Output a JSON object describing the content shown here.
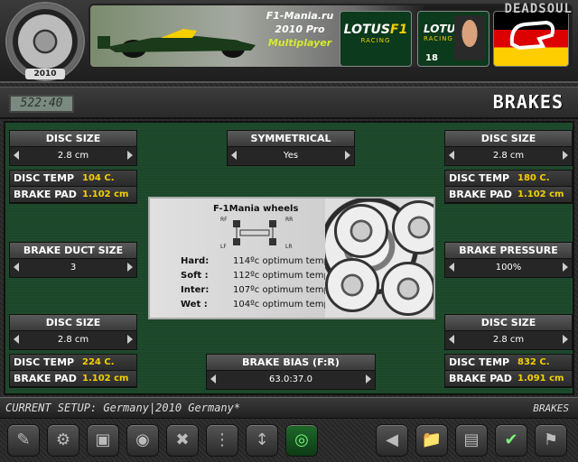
{
  "header": {
    "logo_year": "2010",
    "app_title_line1": "F1-Mania.ru",
    "app_title_line2": "2010 Pro",
    "app_title_line3": "Multiplayer",
    "team_logo_1": {
      "lotus": "LOTUS",
      "f1": "F1",
      "racing": "RACING"
    },
    "team_logo_2": {
      "lotus": "LOTUS",
      "f1": "F1",
      "racing": "RACING"
    },
    "driver_number": "18",
    "brand": "DEADSOUL"
  },
  "subbar": {
    "clock": "522:40",
    "page_title": "BRAKES"
  },
  "settings": {
    "front_left_disc_size": {
      "label": "DISC SIZE",
      "value": "2.8 cm"
    },
    "symmetrical": {
      "label": "SYMMETRICAL",
      "value": "Yes"
    },
    "front_right_disc_size": {
      "label": "DISC SIZE",
      "value": "2.8 cm"
    },
    "brake_duct_size": {
      "label": "BRAKE DUCT SIZE",
      "value": "3"
    },
    "brake_pressure": {
      "label": "BRAKE PRESSURE",
      "value": "100%"
    },
    "rear_left_disc_size": {
      "label": "DISC SIZE",
      "value": "2.8 cm"
    },
    "rear_right_disc_size": {
      "label": "DISC SIZE",
      "value": "2.8 cm"
    },
    "brake_bias": {
      "label": "BRAKE BIAS (F:R)",
      "value": "63.0:37.0"
    }
  },
  "readouts": {
    "front_left": {
      "temp_label": "DISC TEMP",
      "temp": "104 C.",
      "pad_label": "BRAKE PAD",
      "pad": "1.102 cm"
    },
    "front_right": {
      "temp_label": "DISC TEMP",
      "temp": "180 C.",
      "pad_label": "BRAKE PAD",
      "pad": "1.102 cm"
    },
    "rear_left": {
      "temp_label": "DISC TEMP",
      "temp": "224 C.",
      "pad_label": "BRAKE PAD",
      "pad": "1.102 cm"
    },
    "rear_right": {
      "temp_label": "DISC TEMP",
      "temp": "832 C.",
      "pad_label": "BRAKE PAD",
      "pad": "1.091 cm"
    }
  },
  "wheels_info": {
    "title": "F-1Mania wheels",
    "corner_labels": {
      "rf": "RF",
      "rr": "RR",
      "lf": "LF",
      "lr": "LR"
    },
    "rows": [
      {
        "name": "Hard:",
        "temp": "114ºc optimum temp"
      },
      {
        "name": "Soft :",
        "temp": "112ºc optimum temp"
      },
      {
        "name": "Inter:",
        "temp": "107ºc optimum temp"
      },
      {
        "name": "Wet :",
        "temp": "104ºc optimum temp"
      }
    ]
  },
  "status": {
    "setup": "CURRENT SETUP: Germany|2010 Germany*",
    "section": "BRAKES"
  },
  "toolbar": {
    "icons": [
      "clipboard-icon",
      "gears-icon",
      "car-icon",
      "tyre-icon",
      "suspension-icon",
      "spring-icon",
      "damper-icon",
      "brake-disc-icon",
      "back-arrow-icon",
      "folder-icon",
      "notes-icon",
      "wrench-icon",
      "checkered-flag-icon"
    ],
    "active": "brake-disc-icon"
  }
}
